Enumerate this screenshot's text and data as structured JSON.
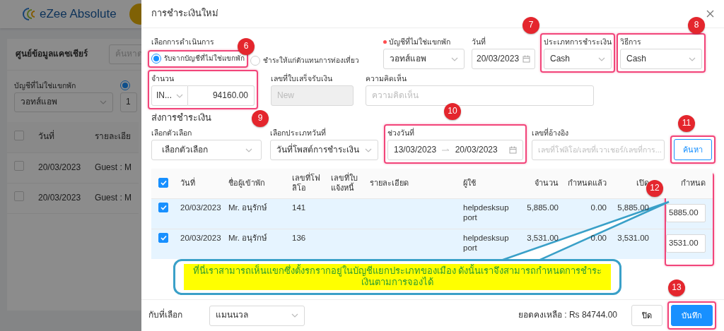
{
  "background": {
    "app_name": "eZee Absolute",
    "panel_title": "ศูนย์ข้อมูลแคชเชียร์",
    "search_placeholder": "ค้นหาด",
    "account_label": "บัญชีที่ไม่ใช่แขกพัก",
    "account_value": "วอทส์แอพ",
    "radio_checked": true,
    "field_value": "1",
    "table": {
      "all_checked": false,
      "columns": [
        "วันที่",
        "รายละเอีย"
      ],
      "rows": [
        {
          "checked": false,
          "cells": [
            "20/03/2023",
            "Guest : M"
          ]
        },
        {
          "checked": false,
          "cells": [
            "20/03/2023",
            "Guest : M"
          ]
        }
      ]
    }
  },
  "dialog": {
    "title": "การชำระเงินใหม่",
    "operation": {
      "label": "เลือกการดำเนินการ",
      "options": [
        {
          "label": "รับจากบัญชีที่ไม่ใช่แขกพัก",
          "selected": true,
          "marker": "6"
        },
        {
          "label": "ชำระให้แก่ตัวแทนการท่องเที่ยว",
          "selected": false
        }
      ]
    },
    "account": {
      "label": "บัญชีที่ไม่ใช่แขกพัก",
      "required": true,
      "value": "วอทส์แอพ"
    },
    "date": {
      "label": "วันที่",
      "value": "20/03/2023"
    },
    "payment_type": {
      "label": "ประเภทการชำระเงิน",
      "value": "Cash",
      "marker": "7"
    },
    "method": {
      "label": "วิธีการ",
      "value": "Cash",
      "marker": "8"
    },
    "amount": {
      "label": "จำนวน",
      "currency": "IN...",
      "value": "94160.00",
      "marker": "9"
    },
    "receipt": {
      "label": "เลขที่ใบเสร็จรับเงิน",
      "placeholder": "New",
      "disabled": true
    },
    "comment": {
      "label": "ความคิดเห็น",
      "placeholder": "ความคิดเห็น"
    },
    "section_title": "ส่งการชำระเงิน",
    "filter_option": {
      "label": "เลือกตัวเลือก",
      "value": "เลือกตัวเลือก"
    },
    "date_type": {
      "label": "เลือกประเภทวันที่",
      "value": "วันที่โพสต์การชำระเงิน"
    },
    "date_range": {
      "label": "ช่วงวันที่",
      "from": "13/03/2023",
      "to": "20/03/2023",
      "marker": "10"
    },
    "reference": {
      "label": "เลขที่อ้างอิง",
      "placeholder": "เลขที่โฟลิโอ/เลขที่เวาเชอร์/เลขที่การ..."
    },
    "search_button": {
      "label": "ค้นหา",
      "marker": "11"
    },
    "table": {
      "all_checked": true,
      "assign_marker": "12",
      "columns": [
        {
          "label": "วันที่",
          "kind": "text"
        },
        {
          "label": "ชื่อผู้เข้าพัก",
          "kind": "text"
        },
        {
          "label": "เลขที่โฟลิโอ",
          "kind": "text"
        },
        {
          "label": "เลขที่ใบแจ้งหนี้",
          "kind": "text"
        },
        {
          "label": "รายละเอียด",
          "kind": "text"
        },
        {
          "label": "ผู้ใช้",
          "kind": "wrap"
        },
        {
          "label": "จำนวน",
          "kind": "number"
        },
        {
          "label": "กำหนดแล้ว",
          "kind": "number"
        },
        {
          "label": "เปิด",
          "kind": "number"
        },
        {
          "label": "กำหนด",
          "kind": "input"
        }
      ],
      "rows": [
        {
          "checked": true,
          "cells": [
            "20/03/2023",
            "Mr. อนุรักษ์",
            "141",
            null,
            null,
            "helpdesksupport",
            "5,885.00",
            "0.00",
            "5,885.00",
            "5885.00"
          ]
        },
        {
          "checked": true,
          "cells": [
            "20/03/2023",
            "Mr. อนุรักษ์",
            "136",
            null,
            null,
            "helpdesksupport",
            "3,531.00",
            "0.00",
            "3,531.00",
            "3531.00"
          ]
        }
      ]
    },
    "callout": {
      "text": "ที่นี่เราสามารถเห็นแขกซึ่งตั้งรกรากอยู่ในบัญชีแยกประเภทของเมือง ดังนั้นเราจึงสามารถกำหนดการชำระเงินตามการจองได้"
    },
    "footer": {
      "apply_label": "กับที่เลือก",
      "apply_value": "แมนนวล",
      "balance": "ยอดคงเหลือ : Rs 84744.00",
      "close_button": "ปิด",
      "save_button": {
        "label": "บันทึก",
        "marker": "13"
      }
    }
  }
}
